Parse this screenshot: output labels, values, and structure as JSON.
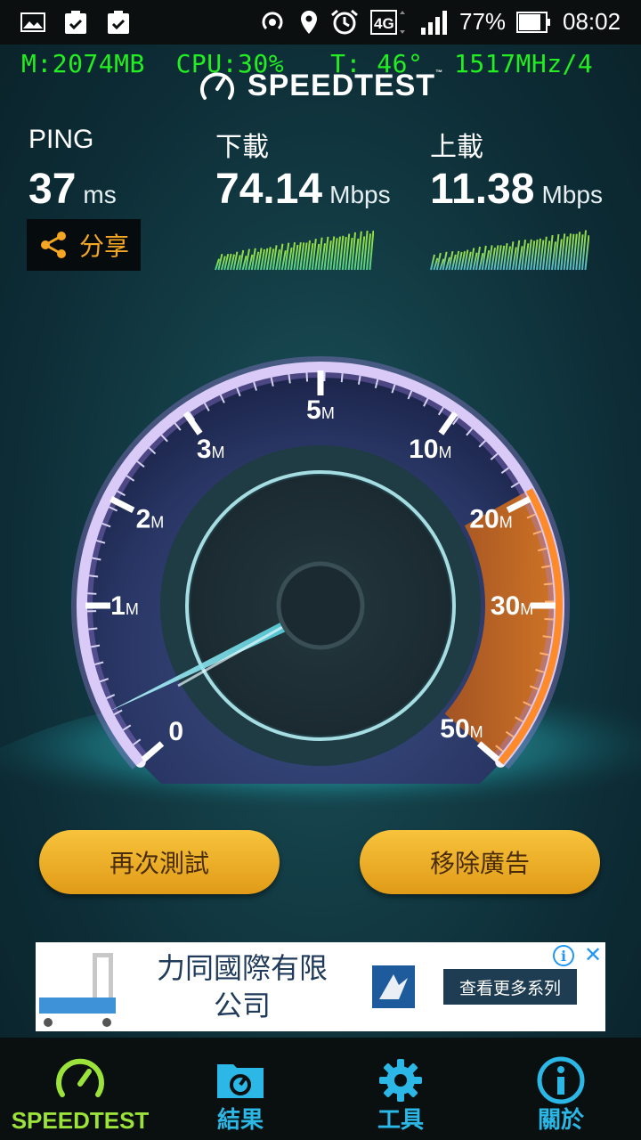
{
  "status_bar": {
    "battery_percent": "77%",
    "time": "08:02",
    "network": "4G"
  },
  "perf_overlay": {
    "memory": "M:2074MB",
    "cpu": "CPU:30%",
    "temp": "T: 46°",
    "freq": "1517MHz/4"
  },
  "app": {
    "logo": "SPEEDTEST",
    "tm": "™"
  },
  "stats": {
    "ping": {
      "label": "PING",
      "value": "37",
      "unit": "ms"
    },
    "download": {
      "label": "下載",
      "value": "74.14",
      "unit": "Mbps"
    },
    "upload": {
      "label": "上載",
      "value": "11.38",
      "unit": "Mbps"
    },
    "share_label": "分享"
  },
  "gauge": {
    "scale_labels": [
      {
        "num": "0",
        "unit": ""
      },
      {
        "num": "1",
        "unit": "M"
      },
      {
        "num": "2",
        "unit": "M"
      },
      {
        "num": "3",
        "unit": "M"
      },
      {
        "num": "5",
        "unit": "M"
      },
      {
        "num": "10",
        "unit": "M"
      },
      {
        "num": "20",
        "unit": "M"
      },
      {
        "num": "30",
        "unit": "M"
      },
      {
        "num": "50",
        "unit": "M"
      }
    ]
  },
  "buttons": {
    "retest": "再次測試",
    "remove_ads": "移除廣告"
  },
  "ad": {
    "title": "力同國際有限公司",
    "cta": "查看更多系列",
    "info": "i",
    "close": "✕"
  },
  "nav": {
    "items": [
      {
        "label": "SPEEDTEST",
        "color": "#9be23a"
      },
      {
        "label": "結果",
        "color": "#2bb8e6"
      },
      {
        "label": "工具",
        "color": "#2bb8e6"
      },
      {
        "label": "關於",
        "color": "#2bb8e6"
      }
    ]
  }
}
